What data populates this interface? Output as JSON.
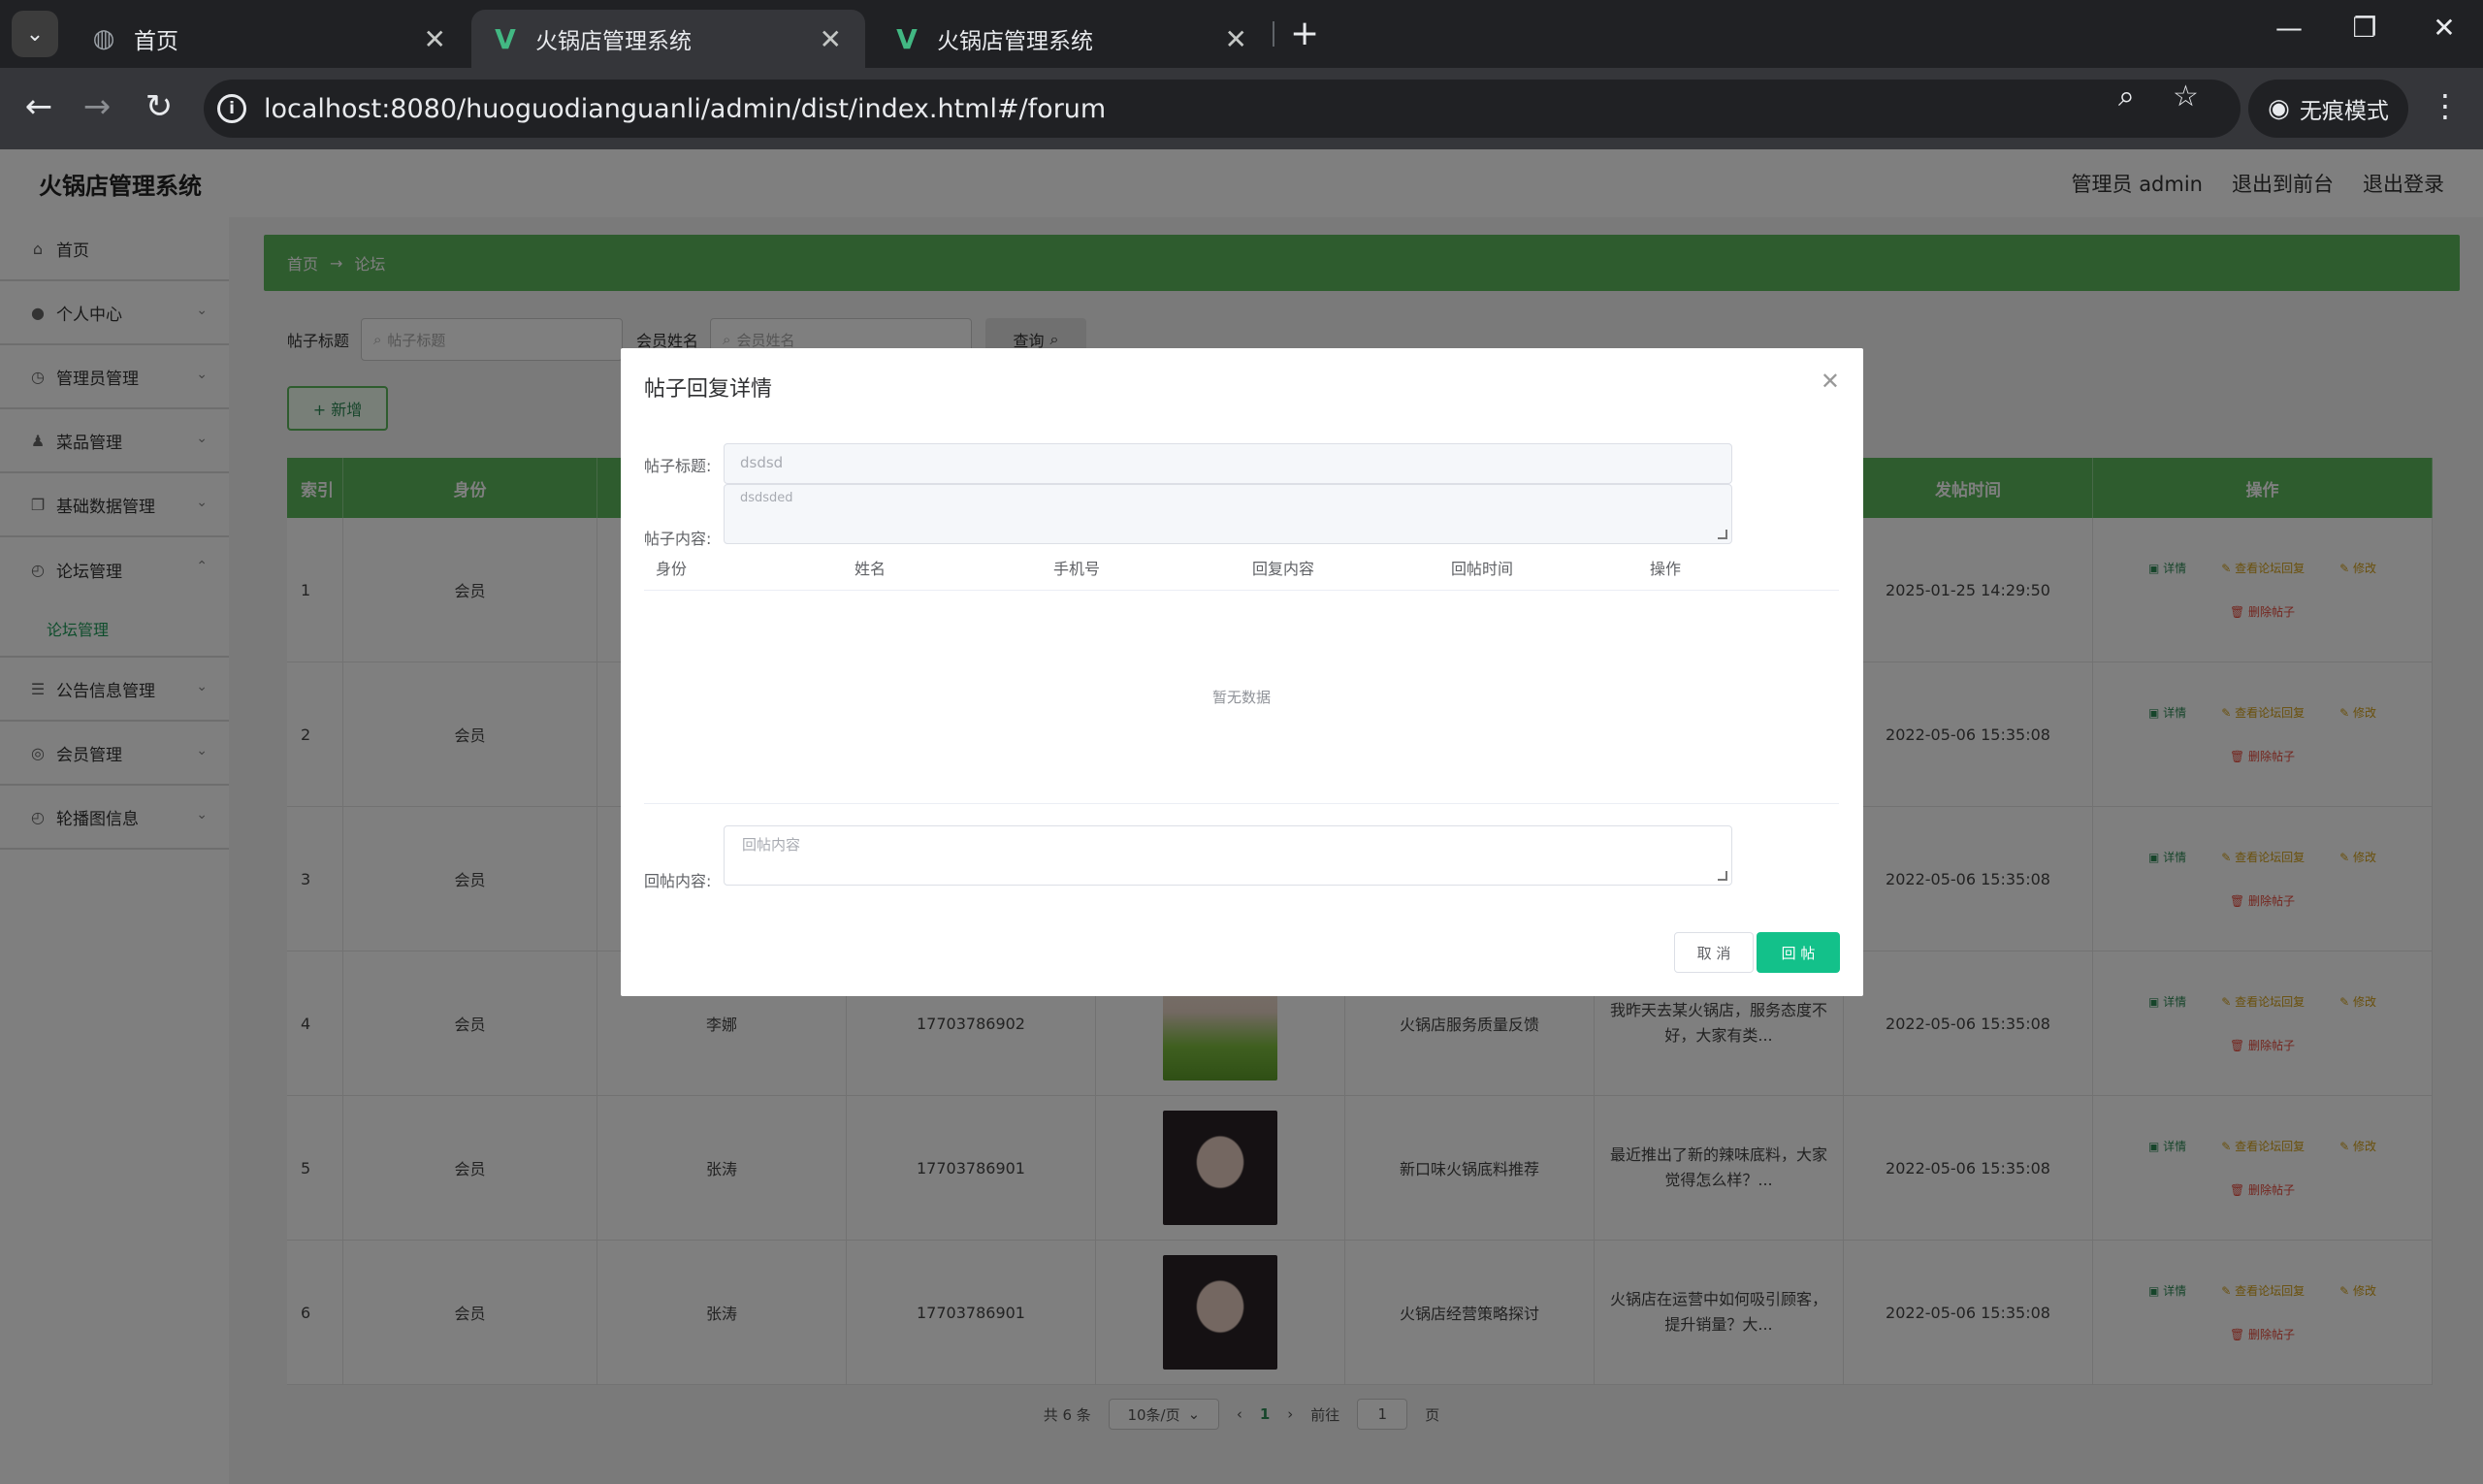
{
  "browser": {
    "tabs": [
      {
        "title": "首页",
        "icon": "globe-icon"
      },
      {
        "title": "火锅店管理系统",
        "icon": "vue-icon"
      },
      {
        "title": "火锅店管理系统",
        "icon": "vue-icon"
      }
    ],
    "url": "localhost:8080/huoguodianguanli/admin/dist/index.html#/forum",
    "incognito_label": "无痕模式"
  },
  "app": {
    "title": "火锅店管理系统",
    "header_links": [
      "管理员 admin",
      "退出到前台",
      "退出登录"
    ]
  },
  "sidebar": {
    "items": [
      {
        "label": "首页",
        "icon": "home-icon"
      },
      {
        "label": "个人中心",
        "icon": "user-icon"
      },
      {
        "label": "管理员管理",
        "icon": "clock-icon"
      },
      {
        "label": "菜品管理",
        "icon": "person-icon"
      },
      {
        "label": "基础数据管理",
        "icon": "copy-icon"
      },
      {
        "label": "论坛管理",
        "icon": "compass-icon"
      },
      {
        "label": "公告信息管理",
        "icon": "list-icon"
      },
      {
        "label": "会员管理",
        "icon": "globe-icon"
      },
      {
        "label": "轮播图信息",
        "icon": "compass-icon"
      }
    ],
    "submenu": {
      "label": "论坛管理"
    }
  },
  "breadcrumb": {
    "home": "首页",
    "sep": "→",
    "current": "论坛"
  },
  "search": {
    "title_label": "帖子标题",
    "title_placeholder": "帖子标题",
    "name_label": "会员姓名",
    "name_placeholder": "会员姓名",
    "query_label": "查询"
  },
  "add_label": "+ 新增",
  "table": {
    "headers": [
      "索引",
      "身份",
      "",
      "",
      "",
      "",
      "",
      "发帖时间",
      "操作"
    ],
    "rows": [
      {
        "idx": "1",
        "role": "会员",
        "name": "",
        "phone": "",
        "title": "",
        "content": "",
        "time": "2025-01-25 14:29:50"
      },
      {
        "idx": "2",
        "role": "会员",
        "name": "",
        "phone": "",
        "title": "",
        "content": "",
        "time": "2022-05-06 15:35:08"
      },
      {
        "idx": "3",
        "role": "会员",
        "name": "",
        "phone": "",
        "title": "",
        "content": "",
        "time": "2022-05-06 15:35:08"
      },
      {
        "idx": "4",
        "role": "会员",
        "name": "李娜",
        "phone": "17703786902",
        "title": "火锅店服务质量反馈",
        "content": "我昨天去某火锅店，服务态度不好，大家有类...",
        "time": "2022-05-06 15:35:08"
      },
      {
        "idx": "5",
        "role": "会员",
        "name": "张涛",
        "phone": "17703786901",
        "title": "新口味火锅底料推荐",
        "content": "最近推出了新的辣味底料，大家觉得怎么样？...",
        "time": "2022-05-06 15:35:08"
      },
      {
        "idx": "6",
        "role": "会员",
        "name": "张涛",
        "phone": "17703786901",
        "title": "火锅店经营策略探讨",
        "content": "火锅店在运营中如何吸引顾客，提升销量？大...",
        "time": "2022-05-06 15:35:08"
      }
    ],
    "ops": {
      "detail": "详情",
      "view_replies": "查看论坛回复",
      "edit": "修改",
      "delete": "删除帖子"
    }
  },
  "pager": {
    "total": "共 6 条",
    "size": "10条/页",
    "prev": "‹",
    "current": "1",
    "next": "›",
    "goto": "前往",
    "goto_value": "1",
    "page_unit": "页"
  },
  "modal": {
    "title": "帖子回复详情",
    "post_title_label": "帖子标题:",
    "post_title_value": "dsdsd",
    "post_content_label": "帖子内容:",
    "post_content_value": "dsdsded",
    "columns": [
      "身份",
      "姓名",
      "手机号",
      "回复内容",
      "回帖时间",
      "操作"
    ],
    "empty": "暂无数据",
    "reply_label": "回帖内容:",
    "reply_placeholder": "回帖内容",
    "cancel": "取 消",
    "submit": "回 帖"
  }
}
